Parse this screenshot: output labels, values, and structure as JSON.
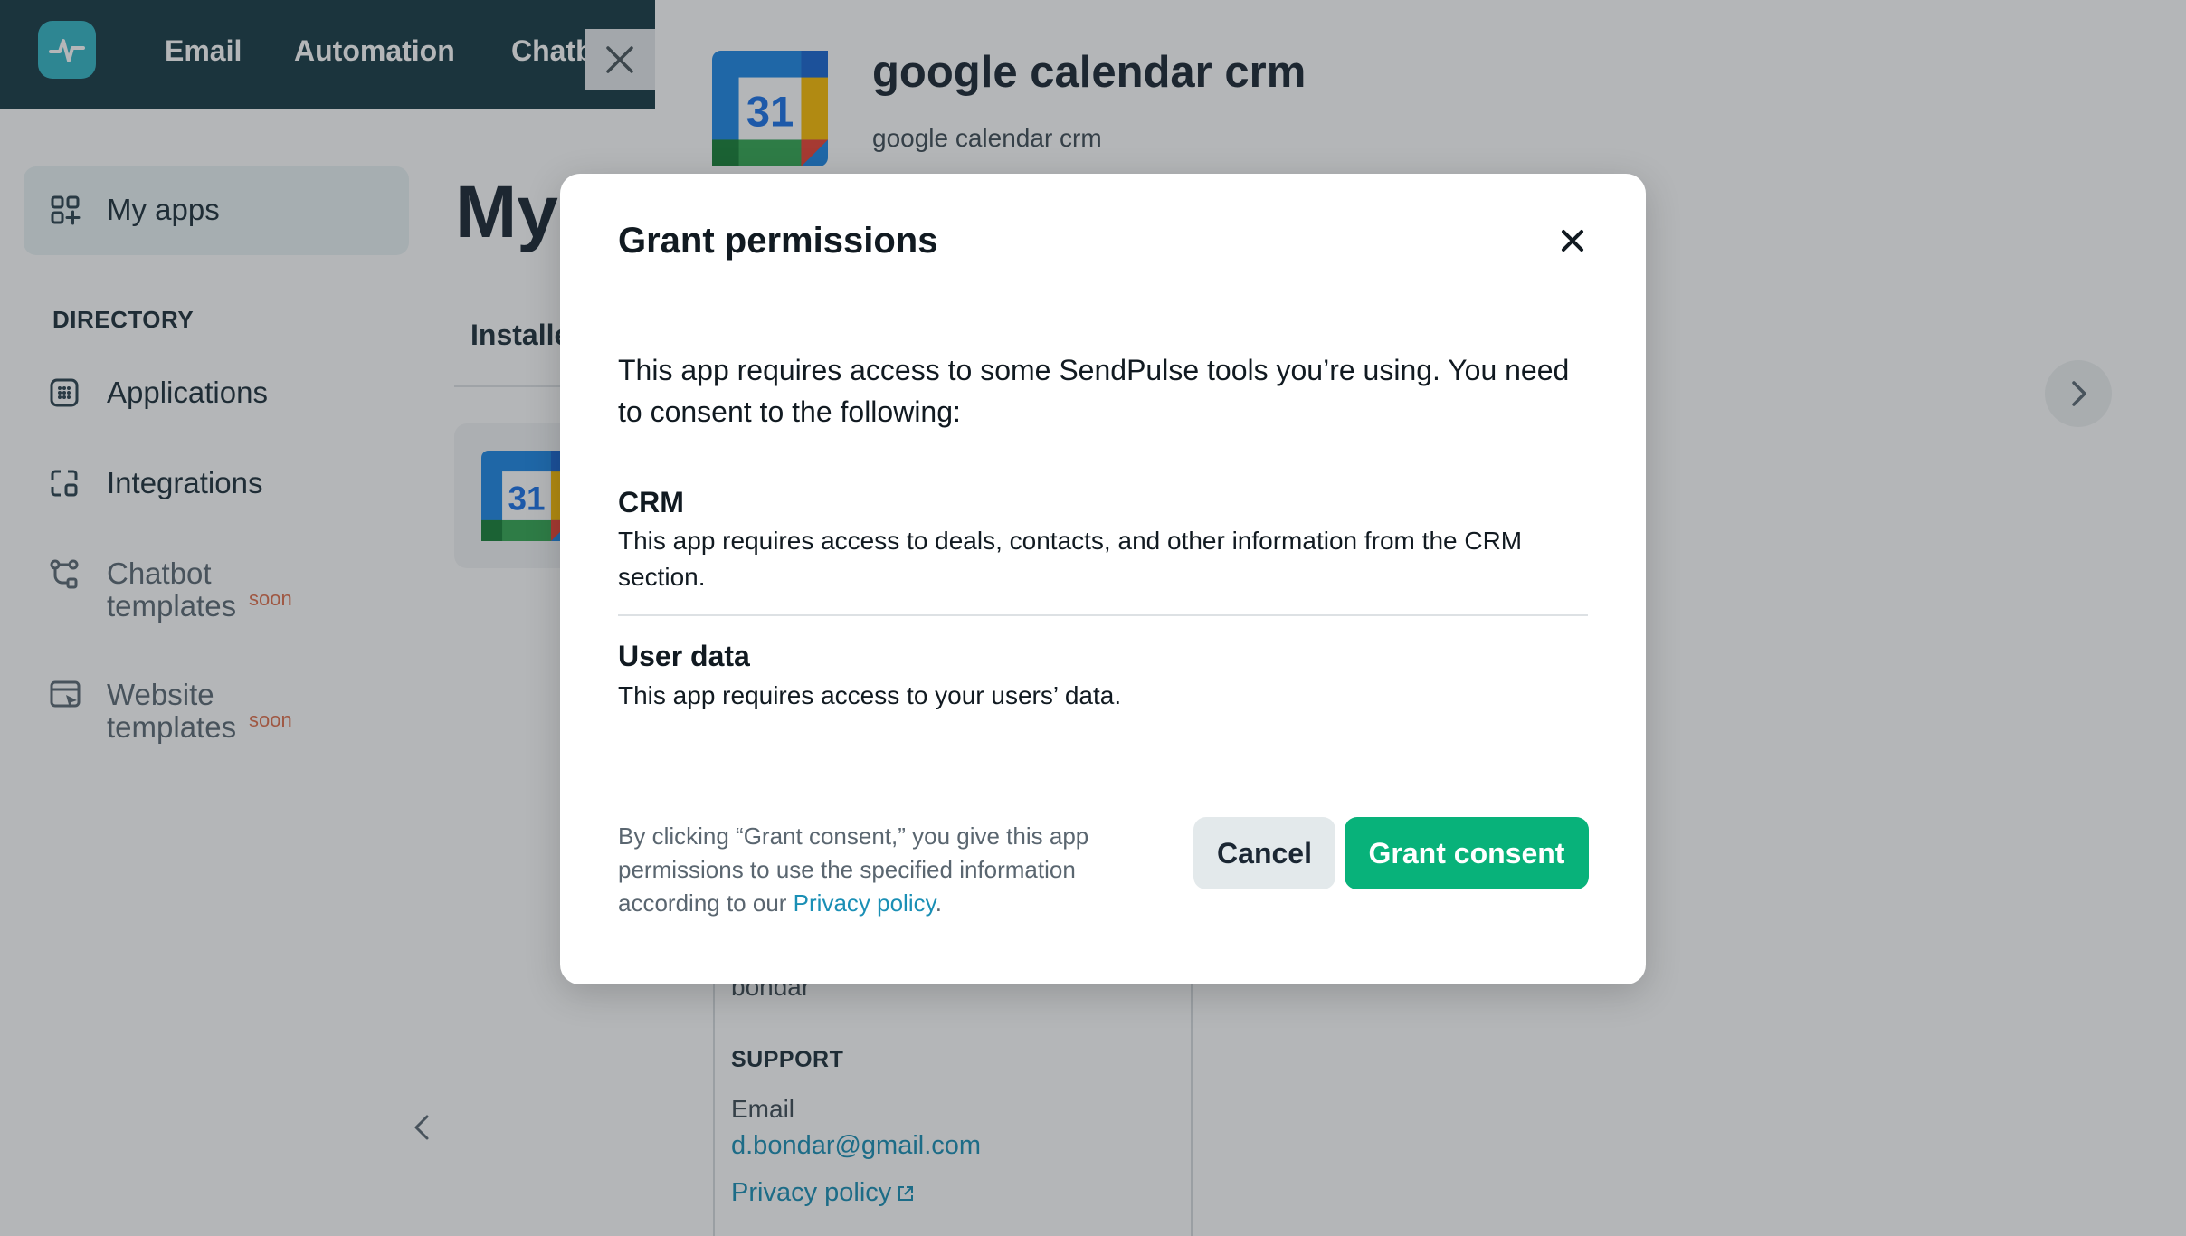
{
  "topnav": {
    "items": [
      "Email",
      "Automation",
      "Chatb"
    ]
  },
  "sidebar": {
    "my_apps": "My apps",
    "directory_heading": "DIRECTORY",
    "items": [
      {
        "label": "Applications"
      },
      {
        "label": "Integrations"
      },
      {
        "label": "Chatbot templates",
        "badge": "soon"
      },
      {
        "label": "Website templates",
        "badge": "soon"
      }
    ]
  },
  "main": {
    "title": "My",
    "tab_installed": "Installe",
    "app_icon_number": "31"
  },
  "app_panel": {
    "icon_number": "31",
    "title": "google calendar crm",
    "subtitle": "google calendar crm",
    "developer": "bondar",
    "support_heading": "SUPPORT",
    "email_label": "Email",
    "email": "d.bondar@gmail.com",
    "privacy_link": "Privacy policy"
  },
  "modal": {
    "title": "Grant permissions",
    "intro": "This app requires access to some SendPulse tools you’re using. You need to consent to the following:",
    "permissions": [
      {
        "title": "CRM",
        "description": "This app requires access to deals, contacts, and other information from the CRM section."
      },
      {
        "title": "User data",
        "description": "This app requires access to your users’ data."
      }
    ],
    "footer_text": "By clicking “Grant consent,” you give this app permissions to use the specified information according to our ",
    "footer_link": "Privacy policy",
    "footer_end": ".",
    "cancel_label": "Cancel",
    "grant_label": "Grant consent"
  },
  "colors": {
    "primary_green": "#08b27a",
    "link_blue": "#1a8fb5",
    "topbar": "#183a45",
    "soon_badge": "#e0704c"
  }
}
